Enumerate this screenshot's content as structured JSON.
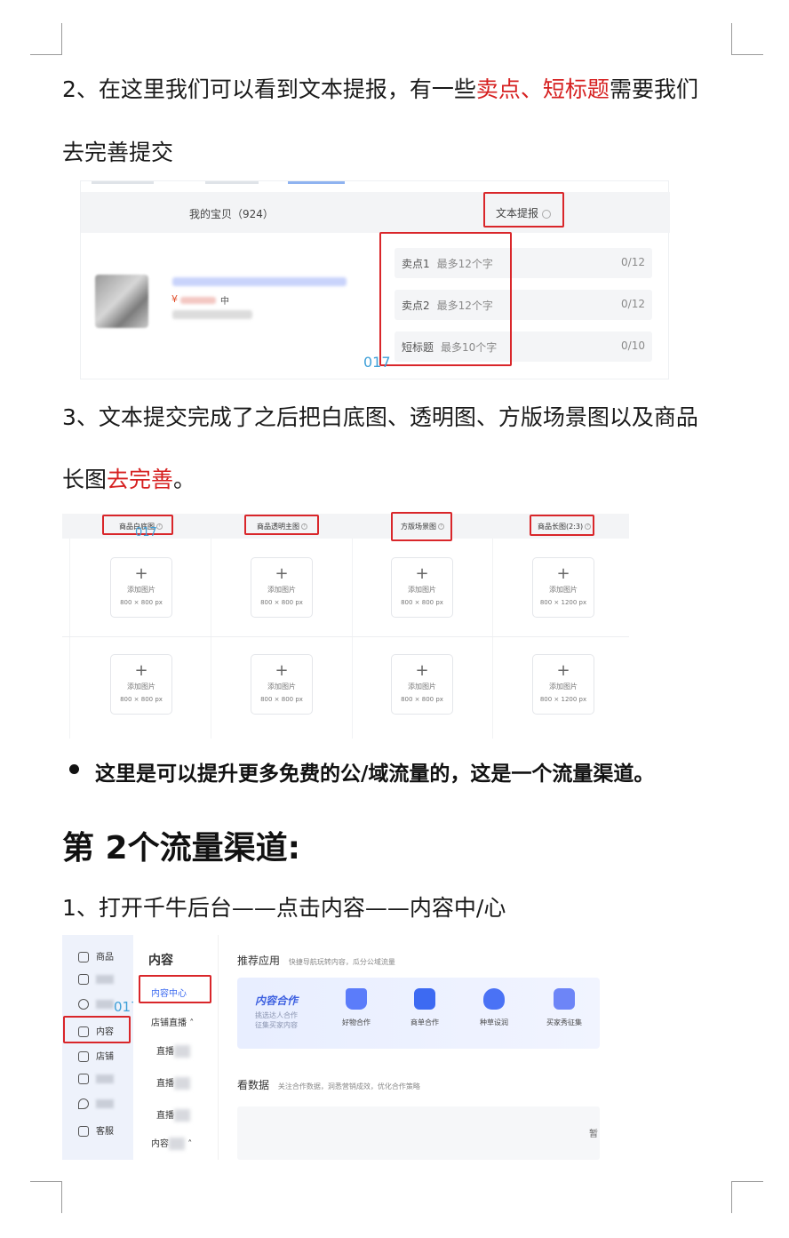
{
  "para1": {
    "line1_a": "2、在这里我们可以看到文本提报，有一些",
    "line1_b": "卖点、短标题",
    "line1_c": "需要我们",
    "line2": "去完善提交"
  },
  "shot1": {
    "tab_baby": "我的宝贝（924）",
    "tab_text": "文本提报",
    "price_symbol": "¥",
    "price_suffix": "中",
    "fields": [
      {
        "label": "卖点1",
        "placeholder": "最多12个字",
        "count": "0/12"
      },
      {
        "label": "卖点2",
        "placeholder": "最多12个字",
        "count": "0/12"
      },
      {
        "label": "短标题",
        "placeholder": "最多10个字",
        "count": "0/10"
      }
    ],
    "watermark": "017"
  },
  "para2": {
    "line1": "3、文本提交完成了之后把白底图、透明图、方版场景图以及商品",
    "line2_a": "长图",
    "line2_b": "去完善",
    "line2_c": "。"
  },
  "shot2": {
    "columns": [
      "商品白底图",
      "商品透明主图",
      "方版场景图",
      "商品长图(2:3)"
    ],
    "add_label": "添加图片",
    "sizes": [
      "800 × 800 px",
      "800 × 800 px",
      "800 × 800 px",
      "800 × 1200 px"
    ],
    "watermark": "017"
  },
  "bullet": "这里是可以提升更多免费的公/域流量的，这是一个流量渠道。",
  "heading": "第 2个流量渠道:",
  "para3": "1、打开千牛后台——点击内容——内容中/心",
  "shot3": {
    "nav": [
      {
        "icon": "product-icon",
        "label": "商品"
      },
      {
        "icon": "order-icon",
        "label": ""
      },
      {
        "icon": "customer-icon",
        "label": ""
      },
      {
        "icon": "content-icon",
        "label": "内容"
      },
      {
        "icon": "store-icon",
        "label": "店铺"
      },
      {
        "icon": "marketing-icon",
        "label": ""
      },
      {
        "icon": "location-icon",
        "label": ""
      },
      {
        "icon": "service-icon",
        "label": "客服"
      }
    ],
    "watermark": "017",
    "section_title": "内容",
    "content_center": "内容中心",
    "live_label": "店铺直播",
    "live_items": [
      "直播",
      "直播",
      "直播"
    ],
    "content_more": "内容",
    "recommend_title": "推荐应用",
    "recommend_sub": "快捷导航玩转内容，瓜分公域流量",
    "card_title": "内容合作",
    "card_sub1": "挑选达人合作",
    "card_sub2": "征集买家内容",
    "apps": [
      {
        "name": "好物合作",
        "color": "#5b7cfa"
      },
      {
        "name": "商单合作",
        "color": "#3d6af2"
      },
      {
        "name": "种草设润",
        "color": "#4a72f5"
      },
      {
        "name": "买家秀征集",
        "color": "#6d85f7"
      }
    ],
    "data_title": "看数据",
    "data_sub": "关注合作数据，洞悉营销成效，优化合作策略",
    "panel_glyph": "暂"
  }
}
